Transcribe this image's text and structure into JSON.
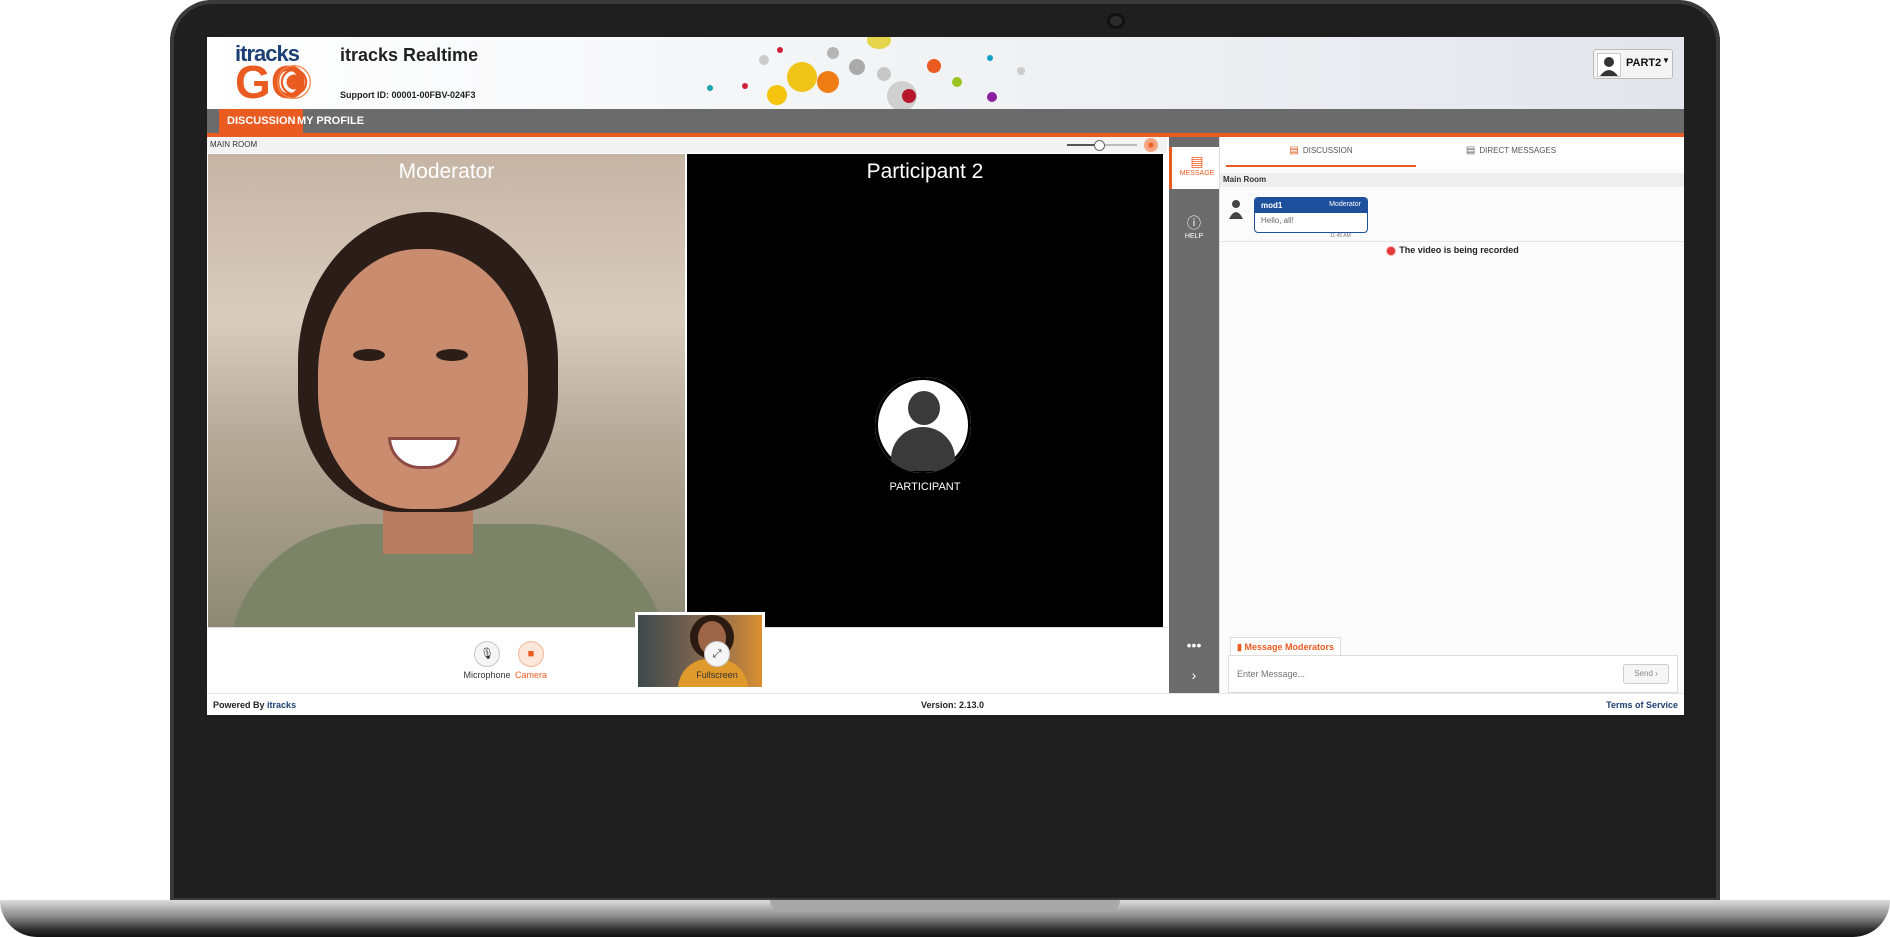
{
  "header": {
    "logo_top": "itracks",
    "logo_bottom": "GO",
    "title": "itracks Realtime",
    "support_id": "Support ID: 00001-00FBV-024F3",
    "user": "PART2"
  },
  "nav": {
    "tabs": [
      "DISCUSSION",
      "MY PROFILE"
    ]
  },
  "room": {
    "label": "MAIN ROOM",
    "volume_fraction": 0.45
  },
  "tiles": {
    "moderator": {
      "label": "Moderator"
    },
    "participant2": {
      "label": "Participant 2",
      "avatar_name": "PARTICIPANT"
    }
  },
  "controls": {
    "microphone": "Microphone",
    "camera": "Camera",
    "fullscreen": "Fullscreen"
  },
  "rail": {
    "message": "MESSAGE",
    "help": "HELP",
    "more": "•••",
    "collapse": "›"
  },
  "chat": {
    "tabs": [
      "DISCUSSION",
      "DIRECT MESSAGES"
    ],
    "room": "Main Room",
    "messages": [
      {
        "user": "mod1",
        "role": "Moderator",
        "text": "Hello, all!",
        "time": "11:45 AM"
      }
    ],
    "recording_notice": "The video is being recorded",
    "message_moderators": "Message Moderators",
    "input_placeholder": "Enter Message...",
    "send": "Send"
  },
  "footer": {
    "powered_by": "Powered By",
    "brand": "itracks",
    "version": "Version: 2.13.0",
    "terms": "Terms of Service"
  },
  "colors": {
    "accent": "#ea5b22",
    "brand_blue": "#1d4f9c",
    "nav_gray": "#6b6b6b"
  }
}
